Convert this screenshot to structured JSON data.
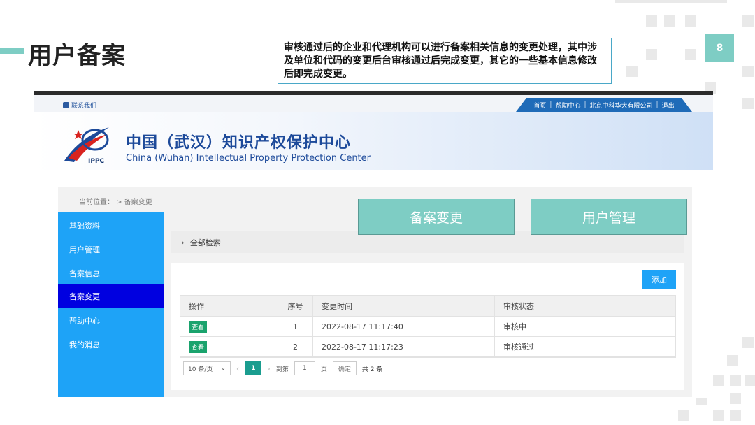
{
  "slide": {
    "title": "用户备案",
    "page_number": "8",
    "note": "审核通过后的企业和代理机构可以进行备案相关信息的变更处理，其中涉及单位和代码的变更后台审核通过后完成变更，其它的一些基本信息修改后即完成变更。",
    "callouts": [
      "备案变更",
      "用户管理"
    ]
  },
  "site": {
    "contact_label": "联系我们",
    "nav_links": [
      "首页",
      "帮助中心",
      "北京中科华大有限公司",
      "退出"
    ],
    "nav_separator": "|",
    "logo_text": "IPPC",
    "title_cn": "中国（武汉）知识产权保护中心",
    "title_en": "China (Wuhan) Intellectual Property Protection Center"
  },
  "breadcrumb": "当前位置：  >  备案变更",
  "sidebar": {
    "items": [
      {
        "label": "基础资料",
        "active": false
      },
      {
        "label": "用户管理",
        "active": false
      },
      {
        "label": "备案信息",
        "active": false
      },
      {
        "label": "备案变更",
        "active": true
      },
      {
        "label": "帮助中心",
        "active": false
      },
      {
        "label": "我的消息",
        "active": false
      }
    ]
  },
  "search": {
    "label": "全部检索",
    "icon": "chevron-right-icon"
  },
  "toolbar": {
    "add_label": "添加"
  },
  "table": {
    "headers": [
      "操作",
      "序号",
      "变更时间",
      "审核状态"
    ],
    "rows": [
      {
        "action": "查看",
        "index": "1",
        "time": "2022-08-17 11:17:40",
        "status": "审核中"
      },
      {
        "action": "查看",
        "index": "2",
        "time": "2022-08-17 11:17:23",
        "status": "审核通过"
      }
    ]
  },
  "pager": {
    "page_size": "10 条/页",
    "current_page": "1",
    "goto_label": "到第",
    "goto_value": "1",
    "page_unit": "页",
    "confirm_label": "确定",
    "total_text": "共 2 条"
  },
  "colors": {
    "accent": "#7ecdc4",
    "sidebar": "#1ea3f7",
    "sidebar_active": "#0000e0",
    "nav": "#1f6bb8",
    "view_button": "#1aa36d"
  }
}
